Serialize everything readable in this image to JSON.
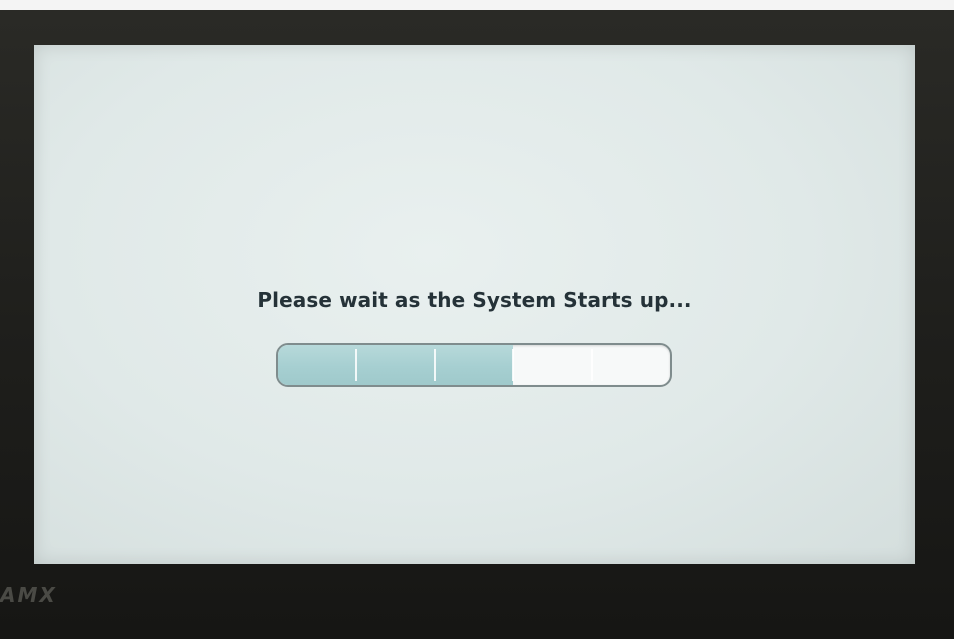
{
  "screen": {
    "message": "Please wait as the System Starts up..."
  },
  "progress": {
    "completed_segments": 3,
    "total_segments": 5,
    "fraction": 0.6
  },
  "device": {
    "brand": "AMX"
  },
  "colors": {
    "progress_fill": "#a6cfd1",
    "message_text": "#253238",
    "bezel": "#1f1f1c"
  }
}
